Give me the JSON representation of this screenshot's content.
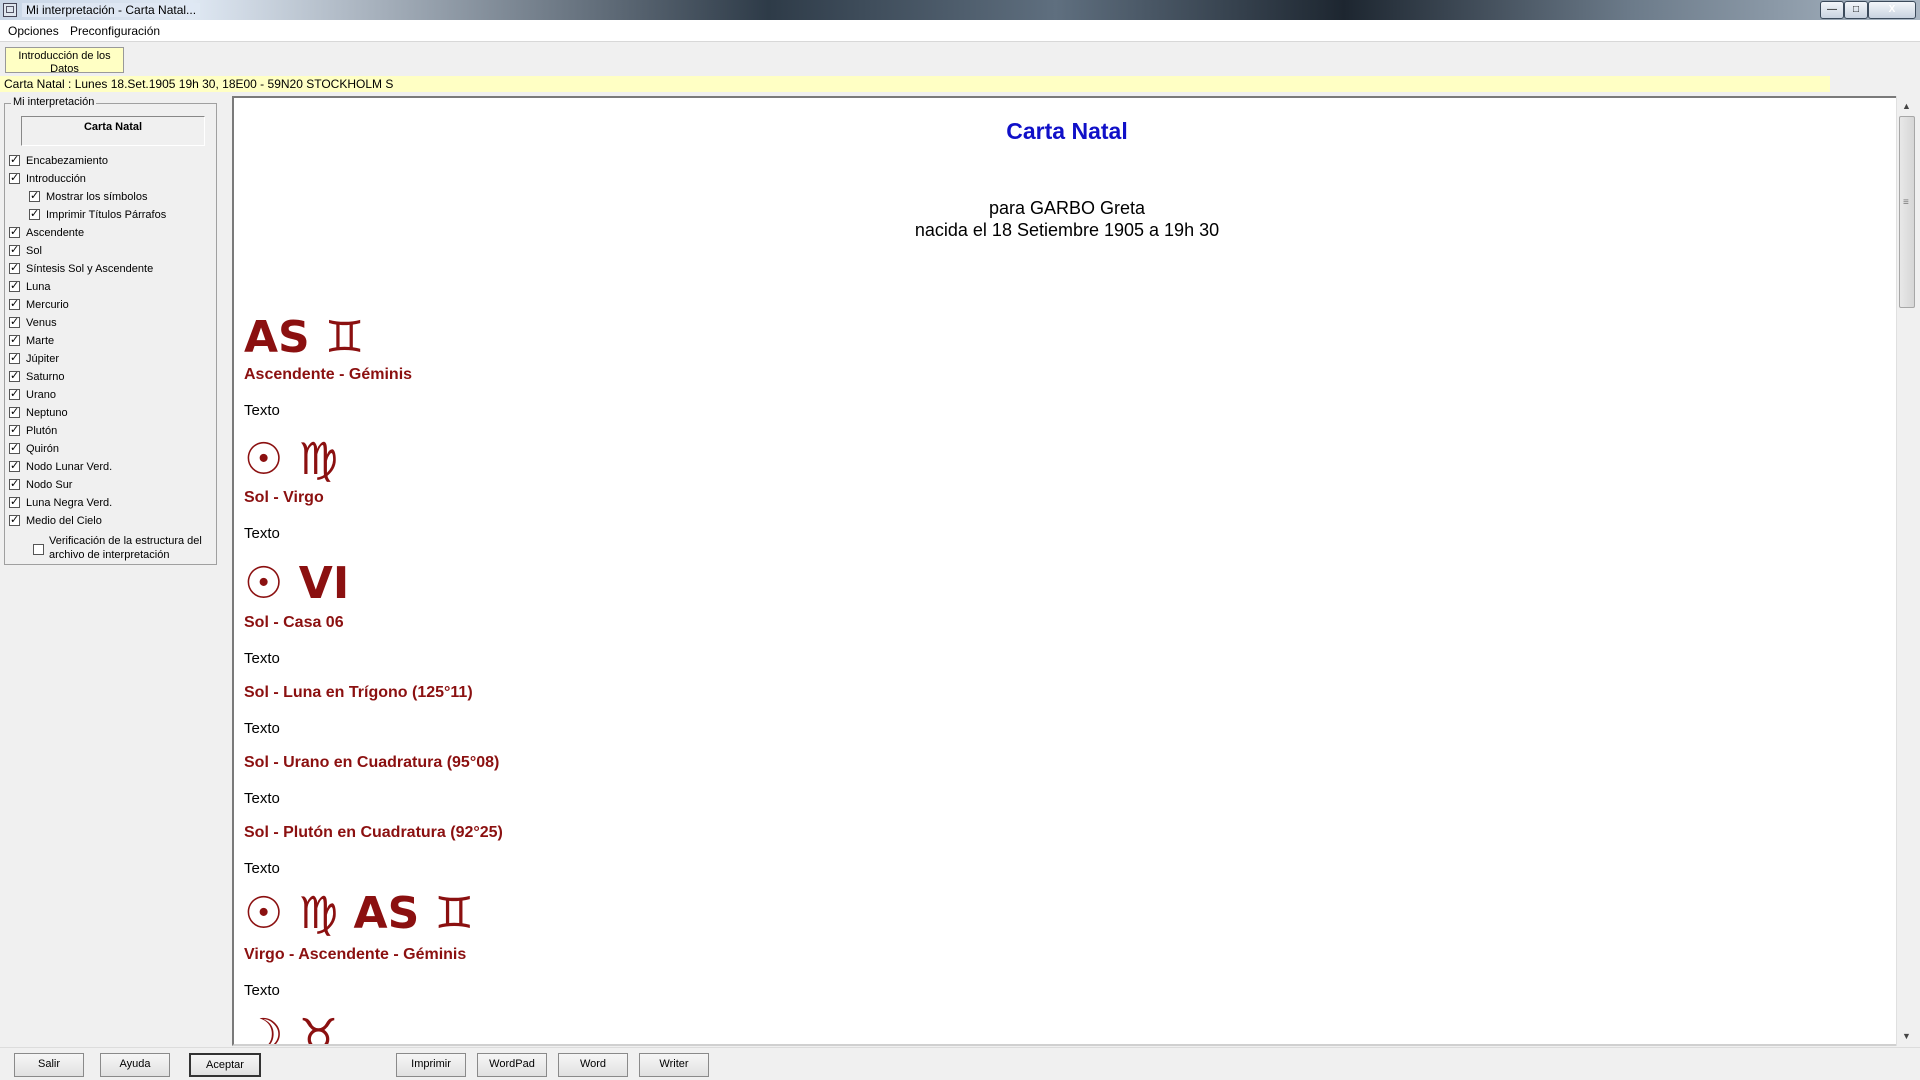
{
  "window": {
    "title": "Mi interpretación - Carta Natal...",
    "controls": {
      "min": "—",
      "max": "□",
      "close": "X"
    }
  },
  "menu": {
    "opciones": "Opciones",
    "preconfig": "Preconfiguración"
  },
  "intro_button": "Introducción de los Datos",
  "info_bar": "Carta Natal : Lunes 18.Set.1905 19h 30, 18E00 - 59N20  STOCKHOLM S",
  "left_panel": {
    "legend": "Mi interpretación",
    "title": "Carta Natal",
    "items": [
      {
        "label": "Encabezamiento",
        "checked": true
      },
      {
        "label": "Introducción",
        "checked": true
      },
      {
        "label": "Mostrar los símbolos",
        "checked": true,
        "indent": true
      },
      {
        "label": "Imprimir Títulos Párrafos",
        "checked": true,
        "indent": true
      },
      {
        "label": "Ascendente",
        "checked": true
      },
      {
        "label": "Sol",
        "checked": true
      },
      {
        "label": "Síntesis Sol y Ascendente",
        "checked": true
      },
      {
        "label": "Luna",
        "checked": true
      },
      {
        "label": "Mercurio",
        "checked": true
      },
      {
        "label": "Venus",
        "checked": true
      },
      {
        "label": "Marte",
        "checked": true
      },
      {
        "label": "Júpiter",
        "checked": true
      },
      {
        "label": "Saturno",
        "checked": true
      },
      {
        "label": "Urano",
        "checked": true
      },
      {
        "label": "Neptuno",
        "checked": true
      },
      {
        "label": "Plutón",
        "checked": true
      },
      {
        "label": "Quirón",
        "checked": true
      },
      {
        "label": "Nodo Lunar Verd.",
        "checked": true
      },
      {
        "label": "Nodo Sur",
        "checked": true
      },
      {
        "label": "Luna Negra Verd.",
        "checked": true
      },
      {
        "label": "Medio del Cielo",
        "checked": true
      }
    ],
    "verification": {
      "label": "Verificación de la estructura del archivo de interpretación",
      "checked": false
    }
  },
  "document": {
    "title": "Carta Natal",
    "for_line": "para GARBO Greta",
    "born_line": "nacida el 18 Setiembre 1905 a 19h 30",
    "sections": [
      {
        "symbol": "AS ♊",
        "heading": "Ascendente - Géminis",
        "text": "Texto"
      },
      {
        "symbol": "☉ ♍",
        "heading": "Sol - Virgo",
        "text": "Texto"
      },
      {
        "symbol": "☉ VI",
        "heading": "Sol - Casa 06",
        "text": "Texto"
      },
      {
        "symbol": "",
        "heading": "Sol - Luna en Trígono (125°11)",
        "text": "Texto"
      },
      {
        "symbol": "",
        "heading": "Sol - Urano en Cuadratura (95°08)",
        "text": "Texto"
      },
      {
        "symbol": "",
        "heading": "Sol - Plutón en Cuadratura (92°25)",
        "text": "Texto"
      },
      {
        "symbol": "☉ ♍ AS ♊",
        "heading": "Virgo - Ascendente - Géminis",
        "text": "Texto"
      },
      {
        "symbol": "☽ ♉",
        "heading": "",
        "text": ""
      }
    ]
  },
  "scrollbar": {
    "up": "▲",
    "down": "▼"
  },
  "buttons": {
    "salir": "Salir",
    "ayuda": "Ayuda",
    "aceptar": "Aceptar",
    "imprimir": "Imprimir",
    "wordpad": "WordPad",
    "word": "Word",
    "writer": "Writer"
  }
}
